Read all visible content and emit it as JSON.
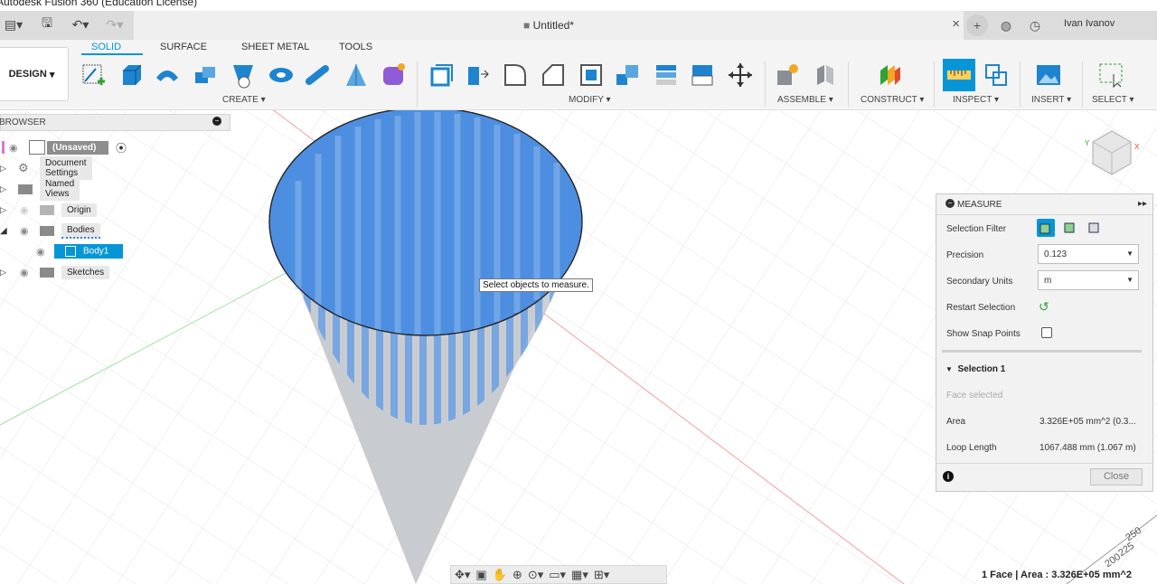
{
  "app_title": "Autodesk Fusion 360 (Education License)",
  "document": {
    "title": "Untitled*"
  },
  "user": {
    "name": "Ivan Ivanov"
  },
  "toolbar": {
    "workspace": "DESIGN",
    "tabs": [
      "SOLID",
      "SURFACE",
      "SHEET METAL",
      "TOOLS"
    ],
    "active_tab": "SOLID",
    "groups": {
      "create": "CREATE",
      "modify": "MODIFY",
      "assemble": "ASSEMBLE",
      "construct": "CONSTRUCT",
      "inspect": "INSPECT",
      "insert": "INSERT",
      "select": "SELECT"
    }
  },
  "browser": {
    "title": "BROWSER",
    "items": [
      {
        "label": "(Unsaved)"
      },
      {
        "label": "Document Settings"
      },
      {
        "label": "Named Views"
      },
      {
        "label": "Origin"
      },
      {
        "label": "Bodies"
      },
      {
        "label": "Body1"
      },
      {
        "label": "Sketches"
      }
    ]
  },
  "tooltip": "Select objects to measure.",
  "measure": {
    "title": "MEASURE",
    "selection_filter_label": "Selection Filter",
    "precision_label": "Precision",
    "precision_value": "0.123",
    "secondary_units_label": "Secondary Units",
    "secondary_units_value": "m",
    "restart_label": "Restart Selection",
    "snap_label": "Show Snap Points",
    "selection_header": "Selection 1",
    "face_selected": "Face selected",
    "area_label": "Area",
    "area_value": "3.326E+05 mm^2 (0.3...",
    "loop_label": "Loop Length",
    "loop_value": "1067.488 mm (1.067 m)",
    "close_label": "Close"
  },
  "status": "1 Face | Area : 3.326E+05 mm^2",
  "ruler_ticks": [
    "250",
    "225",
    "200"
  ],
  "colors": {
    "accent": "#0696d7",
    "body_face": "#4d8ee0",
    "body_gray": "#c8ccd1"
  }
}
